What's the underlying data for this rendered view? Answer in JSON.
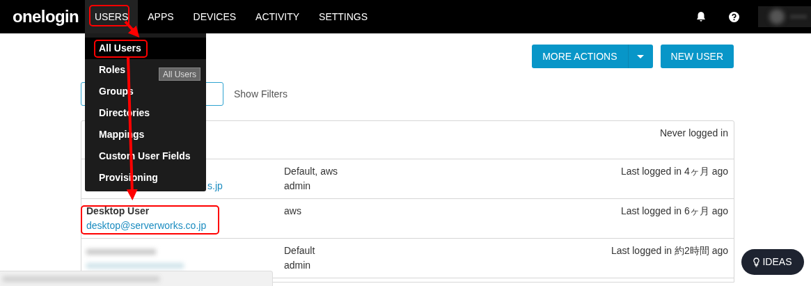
{
  "nav": {
    "logo": "onelogin",
    "items": [
      {
        "label": "USERS",
        "selected": true
      },
      {
        "label": "APPS",
        "selected": false
      },
      {
        "label": "DEVICES",
        "selected": false
      },
      {
        "label": "ACTIVITY",
        "selected": false
      },
      {
        "label": "SETTINGS",
        "selected": false
      }
    ]
  },
  "users_menu": [
    {
      "label": "All Users",
      "selected": true
    },
    {
      "label": "Roles",
      "selected": false
    },
    {
      "label": "Groups",
      "selected": false
    },
    {
      "label": "Directories",
      "selected": false
    },
    {
      "label": "Mappings",
      "selected": false
    },
    {
      "label": "Custom User Fields",
      "selected": false
    },
    {
      "label": "Provisioning",
      "selected": false
    }
  ],
  "tooltip": "All Users",
  "actions": {
    "more_actions": "MORE ACTIONS",
    "new_user": "NEW USER"
  },
  "show_filters": "Show Filters",
  "users": [
    {
      "redacted": false,
      "last_login": "Never logged in"
    },
    {
      "redacted": false,
      "email": "s.jp",
      "details": [
        "Default, aws",
        "admin"
      ],
      "last_login": "Last logged in 4ヶ月 ago"
    },
    {
      "redacted": false,
      "name": "Desktop User",
      "email": "desktop@serverworks.co.jp",
      "details": [
        "aws"
      ],
      "last_login": "Last logged in 6ヶ月 ago"
    },
    {
      "redacted": true,
      "details": [
        "Default",
        "admin"
      ],
      "last_login": "Last logged in 約2時間 ago"
    }
  ],
  "ideas_button": "IDEAS"
}
